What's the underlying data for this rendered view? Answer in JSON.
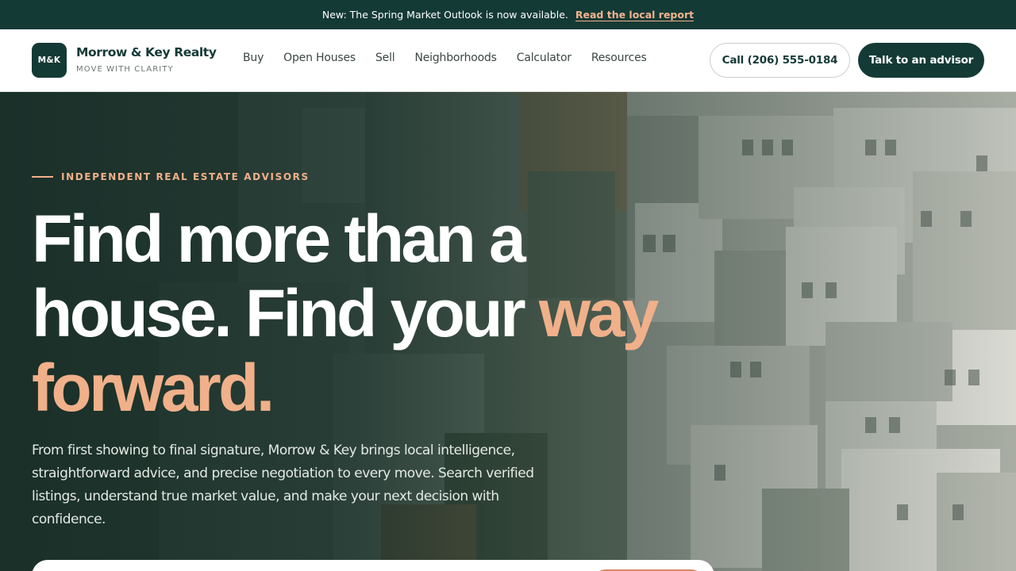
{
  "announcement": {
    "text": "New: The Spring Market Outlook is now available.",
    "link": "Read the local report"
  },
  "header": {
    "logo_mark": "M&K",
    "brand_name": "Morrow & Key Realty",
    "tagline": "MOVE WITH CLARITY",
    "nav": [
      "Buy",
      "Open Houses",
      "Sell",
      "Neighborhoods",
      "Calculator",
      "Resources"
    ],
    "call_button": "Call (206) 555-0184",
    "cta_button": "Talk to an advisor"
  },
  "hero": {
    "eyebrow": "INDEPENDENT REAL ESTATE ADVISORS",
    "headline_white_1": "Find more than a",
    "headline_white_2": "house. Find your",
    "headline_accent_1": "way",
    "headline_accent_2": "forward.",
    "lead": "From first showing to final signature, Morrow & Key brings local intelligence, straightforward advice, and precise negotiation to every move. Search verified listings, understand true market value, and make your next decision with confidence."
  },
  "colors": {
    "brand_dark": "#143a36",
    "accent": "#f0b08a",
    "announce_bg": "#143a36"
  }
}
